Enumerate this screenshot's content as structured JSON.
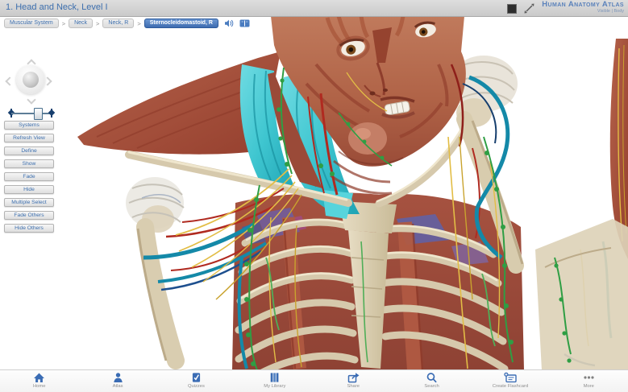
{
  "titlebar": {
    "title": "1. Head and Neck, Level I",
    "logo_title": "Human Anatomy Atlas",
    "logo_subtitle": "Visible | Body"
  },
  "breadcrumb": {
    "separator": ">",
    "items": [
      "Muscular System",
      "Neck",
      "Neck, R"
    ],
    "selected": "Sternocleidomastoid, R"
  },
  "nav_controls": {
    "buttons": [
      "Systems",
      "Refresh View",
      "Define",
      "Show",
      "Fade",
      "Hide",
      "Multiple Select",
      "Fade Others",
      "Hide Others"
    ]
  },
  "toolbar": {
    "items": [
      "Home",
      "Atlas",
      "Quizzes",
      "My Library",
      "Share",
      "Search",
      "Create Flashcard",
      "More"
    ]
  },
  "scene": {
    "highlighted_structure": "Sternocleidomastoid, R",
    "highlight_color": "#3fc6d0"
  },
  "colors": {
    "accent_blue": "#3d6fae",
    "selected_chip": "#3e6cb0",
    "muscle_red": "#a34a35",
    "bone": "#d8ccae",
    "artery": "#b02a20",
    "vein": "#1489a8",
    "nerve": "#e2bd45",
    "lymph": "#2f9e44"
  }
}
